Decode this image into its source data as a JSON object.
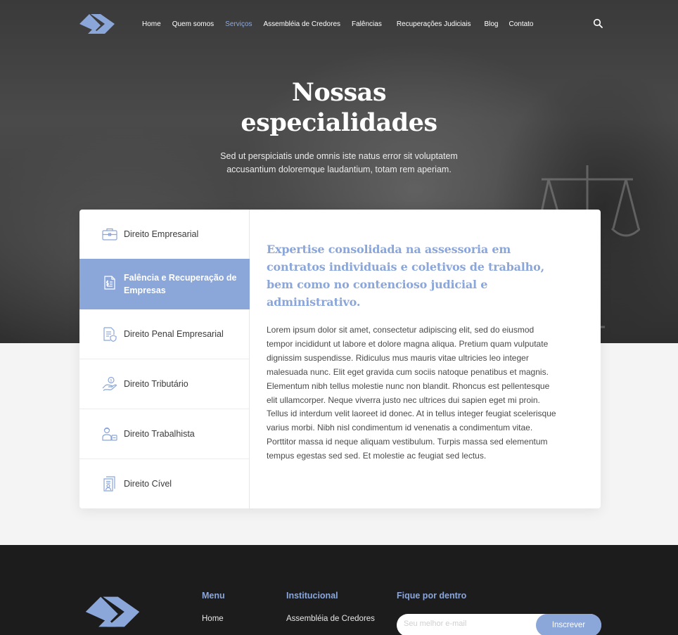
{
  "header": {
    "nav": [
      {
        "label": "Home",
        "active": false
      },
      {
        "label": "Quem somos",
        "active": false
      },
      {
        "label": "Serviços",
        "active": true
      },
      {
        "label": "Assembléia de Credores",
        "active": false
      },
      {
        "label": "Falências",
        "active": false
      },
      {
        "label": "Recuperações Judiciais",
        "active": false
      },
      {
        "label": "Blog",
        "active": false
      },
      {
        "label": "Contato",
        "active": false
      }
    ],
    "search_icon": "search-icon",
    "logo_icon": "brand-logo"
  },
  "hero": {
    "title_line1": "Nossas",
    "title_line2": "especialidades",
    "subtitle": "Sed ut perspiciatis unde omnis iste natus error sit voluptatem accusantium doloremque laudantium, totam rem aperiam."
  },
  "services": {
    "tabs": [
      {
        "label": "Direito Empresarial",
        "icon": "briefcase-icon",
        "active": false
      },
      {
        "label": "Falência e Recuperação de Empresas",
        "icon": "document-money-icon",
        "active": true
      },
      {
        "label": "Direito Penal Empresarial",
        "icon": "document-shield-icon",
        "active": false
      },
      {
        "label": "Direito Tributário",
        "icon": "hand-coin-icon",
        "active": false
      },
      {
        "label": "Direito Trabalhista",
        "icon": "worker-icon",
        "active": false
      },
      {
        "label": "Direito Cível",
        "icon": "document-person-icon",
        "active": false
      }
    ],
    "content_title": "Expertise consolidada na assessoria em contratos individuais e coletivos de trabalho, bem como no contencioso judicial e administrativo.",
    "content_body": "Lorem ipsum dolor sit amet, consectetur adipiscing elit, sed do eiusmod tempor incididunt ut labore et dolore magna aliqua. Pretium quam vulputate dignissim suspendisse. Ridiculus mus mauris vitae ultricies leo integer malesuada nunc. Elit eget gravida cum sociis natoque penatibus et magnis. Elementum nibh tellus molestie nunc non blandit. Rhoncus est pellentesque elit ullamcorper. Neque viverra justo nec ultrices dui sapien eget mi proin. Tellus id interdum velit laoreet id donec. At in tellus integer feugiat scelerisque varius morbi. Nibh nisl condimentum id venenatis a condimentum vitae. Porttitor massa id neque aliquam vestibulum. Turpis massa sed elementum tempus egestas sed sed. Et molestie ac feugiat sed lectus."
  },
  "footer": {
    "menu_title": "Menu",
    "menu_link": "Home",
    "institutional_title": "Institucional",
    "institutional_link": "Assembléia de Credores",
    "newsletter_title": "Fique por dentro",
    "email_placeholder": "Seu melhor e-mail",
    "subscribe_label": "Inscrever"
  },
  "colors": {
    "accent": "#8ba6d9",
    "footer_bg": "#1c1c1d",
    "hero_bg": "#3a3a3a"
  }
}
